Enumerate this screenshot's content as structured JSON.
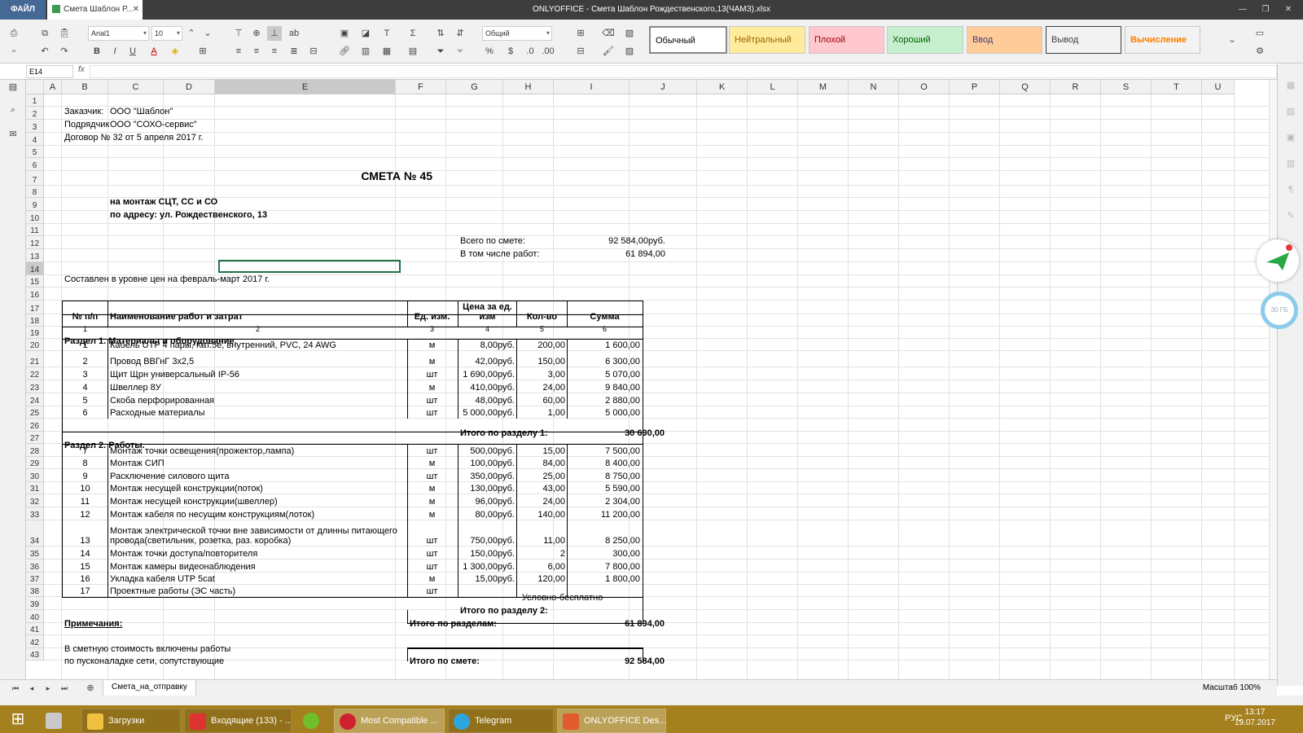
{
  "titlebar": {
    "file": "ФАЙЛ",
    "doc_tab": "Смета Шаблон Р...",
    "window_title": "ONLYOFFICE - Смета Шаблон Рождественского,13(ЧАМЗ).xlsx"
  },
  "toolbar": {
    "font": "Arial1",
    "size": "10",
    "numfmt": "Общий",
    "styles": [
      "Обычный",
      "Нейтральный",
      "Плохой",
      "Хороший",
      "Ввод",
      "Вывод",
      "Вычисление"
    ]
  },
  "formula": {
    "cellref": "E14",
    "fx": "fx",
    "content": ""
  },
  "columns": [
    "A",
    "B",
    "C",
    "D",
    "E",
    "F",
    "G",
    "H",
    "I",
    "J",
    "K",
    "L",
    "M",
    "N",
    "O",
    "P",
    "Q",
    "R",
    "S",
    "T",
    "U"
  ],
  "rows": [
    "1",
    "2",
    "3",
    "4",
    "5",
    "6",
    "7",
    "8",
    "9",
    "10",
    "11",
    "12",
    "13",
    "14",
    "15",
    "16",
    "17",
    "18",
    "19",
    "20",
    "21",
    "22",
    "23",
    "24",
    "25",
    "26",
    "27",
    "28",
    "29",
    "30",
    "31",
    "32",
    "33",
    "34",
    "35",
    "36",
    "37",
    "38",
    "39",
    "40",
    "41",
    "42",
    "43"
  ],
  "header": {
    "l2": "Заказчик:",
    "v2": "ООО \"Шаблон\"",
    "l3": "Подрядчик",
    "v3": "ООО \"СОХО-сервис\"",
    "l4": "Договор № 32 от 5 апреля 2017 г.",
    "title": "СМЕТА № 45",
    "sub1": "на монтаж СЦТ, СС и СО",
    "sub2": "по адресу: ул. Рождественского, 13",
    "total_label": "Всего по смете:",
    "total_value": "92 584,00руб.",
    "works_label": "В том числе работ:",
    "works_value": "61 894,00",
    "priced": "Составлен в уровне цен на февраль-март 2017 г."
  },
  "table": {
    "h_num": "№ п/п",
    "h_name": "Наименование работ и затрат",
    "h_unit": "Ед. изм.",
    "h_price": "Цена за ед. изм",
    "h_qty": "Кол-во",
    "h_sum": "Сумма",
    "n1": "1",
    "n2": "2",
    "n3": "3",
    "n4": "4",
    "n5": "5",
    "n6": "6",
    "sec1": "Раздел 1. Материалы и оборудование.",
    "sec2": "Раздел 2. Работы.",
    "sub1_label": "Итого по разделу 1:",
    "sub1_value": "30 690,00",
    "sub2_label": "Итого по разделу 2:",
    "free": "Условно-бесплатно",
    "all_label": "Итого по разделам:",
    "all_value": "61 894,00",
    "est_label": "Итого по смете:",
    "est_value": "92 584,00"
  },
  "items": [
    {
      "num": "1",
      "name": "Кабель UTP 4 пары, Кат.5е, внутренний, PVC, 24 AWG",
      "unit": "м",
      "price": "8,00руб.",
      "qty": "200,00",
      "sum": "1 600,00"
    },
    {
      "num": "2",
      "name": "Провод ВВГнГ 3х2,5",
      "unit": "м",
      "price": "42,00руб.",
      "qty": "150,00",
      "sum": "6 300,00"
    },
    {
      "num": "3",
      "name": "Щит Щрн универсальный IP-56",
      "unit": "шт",
      "price": "1 690,00руб.",
      "qty": "3,00",
      "sum": "5 070,00"
    },
    {
      "num": "4",
      "name": "Швеллер 8У",
      "unit": "м",
      "price": "410,00руб.",
      "qty": "24,00",
      "sum": "9 840,00"
    },
    {
      "num": "5",
      "name": "Скоба перфорированная",
      "unit": "шт",
      "price": "48,00руб.",
      "qty": "60,00",
      "sum": "2 880,00"
    },
    {
      "num": "6",
      "name": "Расходные материалы",
      "unit": "шт",
      "price": "5 000,00руб.",
      "qty": "1,00",
      "sum": "5 000,00"
    },
    {
      "num": "7",
      "name": "Монтаж точки освещения(прожектор,лампа)",
      "unit": "шт",
      "price": "500,00руб.",
      "qty": "15,00",
      "sum": "7 500,00"
    },
    {
      "num": "8",
      "name": "Монтаж СИП",
      "unit": "м",
      "price": "100,00руб.",
      "qty": "84,00",
      "sum": "8 400,00"
    },
    {
      "num": "9",
      "name": "Расключение силового щита",
      "unit": "шт",
      "price": "350,00руб.",
      "qty": "25,00",
      "sum": "8 750,00"
    },
    {
      "num": "10",
      "name": "Монтаж несущей конструкции(поток)",
      "unit": "м",
      "price": "130,00руб.",
      "qty": "43,00",
      "sum": "5 590,00"
    },
    {
      "num": "11",
      "name": "Монтаж несущей конструкции(швеллер)",
      "unit": "м",
      "price": "96,00руб.",
      "qty": "24,00",
      "sum": "2 304,00"
    },
    {
      "num": "12",
      "name": "Монтаж кабеля по несущим конструкциям(лоток)",
      "unit": "м",
      "price": "80,00руб.",
      "qty": "140,00",
      "sum": "11 200,00"
    },
    {
      "num": "13",
      "name": "Монтаж электрической точки вне зависимости от длинны питающего провода(светильник, розетка, раз. коробка)",
      "unit": "шт",
      "price": "750,00руб.",
      "qty": "11,00",
      "sum": "8 250,00"
    },
    {
      "num": "14",
      "name": "Монтаж точки доступа/повторителя",
      "unit": "шт",
      "price": "150,00руб.",
      "qty": "2",
      "sum": "300,00"
    },
    {
      "num": "15",
      "name": "Монтаж камеры видеонаблюдения",
      "unit": "шт",
      "price": "1 300,00руб.",
      "qty": "6,00",
      "sum": "7 800,00"
    },
    {
      "num": "16",
      "name": "Укладка кабеля UTP 5cat",
      "unit": "м",
      "price": "15,00руб.",
      "qty": "120,00",
      "sum": "1 800,00"
    },
    {
      "num": "17",
      "name": "Проектные работы (ЭС часть)",
      "unit": "шт",
      "price": "",
      "qty": "",
      "sum": ""
    }
  ],
  "notes": {
    "label": "Примечания:",
    "l42": "В сметную стоимость включены работы",
    "l43": "по пусконаладке сети, сопутствующие"
  },
  "sheet": {
    "tab": "Смета_на_отправку",
    "zoom": "Масштаб 100%"
  },
  "side": {
    "storage": "30 ГБ"
  },
  "taskbar": {
    "items": [
      "Загрузки",
      "Входящие (133) - ...",
      "Most Compatible ...",
      "Telegram",
      "ONLYOFFICE Des..."
    ],
    "lang": "РУС",
    "time": "13:17",
    "date": "19.07.2017"
  }
}
